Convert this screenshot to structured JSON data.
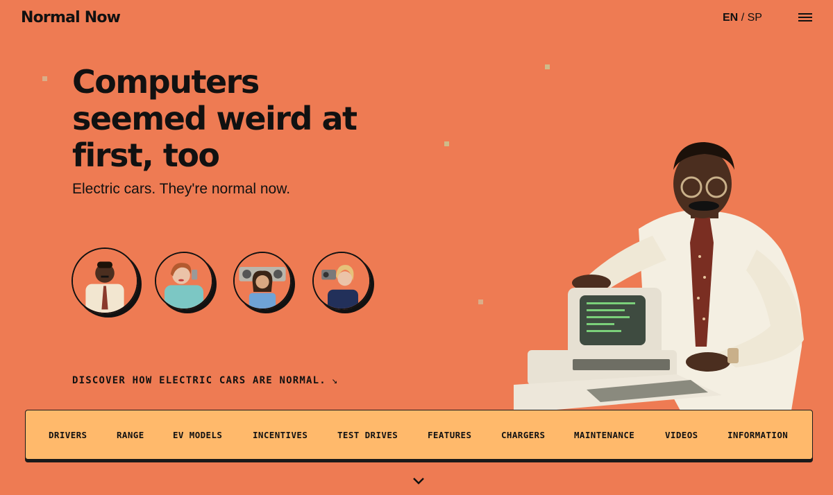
{
  "header": {
    "logo": "Normal Now",
    "lang_active": "EN",
    "lang_separator": "/",
    "lang_other": "SP",
    "menu_icon": "hamburger-icon"
  },
  "hero": {
    "headline": "Computers seemed weird at first, too",
    "subheadline": "Electric cars. They're normal now.",
    "cta_label": "DISCOVER HOW ELECTRIC CARS ARE NORMAL.",
    "cta_icon": "arrow-down-right-icon"
  },
  "nav": {
    "items": [
      {
        "label": "DRIVERS"
      },
      {
        "label": "RANGE"
      },
      {
        "label": "EV MODELS"
      },
      {
        "label": "INCENTIVES"
      },
      {
        "label": "TEST DRIVES"
      },
      {
        "label": "FEATURES"
      },
      {
        "label": "CHARGERS"
      },
      {
        "label": "MAINTENANCE"
      },
      {
        "label": "VIDEOS"
      },
      {
        "label": "INFORMATION"
      }
    ]
  },
  "scroll_icon": "chevron-down-icon",
  "colors": {
    "background": "#EE7B53",
    "nav_background": "#FFB96B",
    "text": "#111111"
  }
}
